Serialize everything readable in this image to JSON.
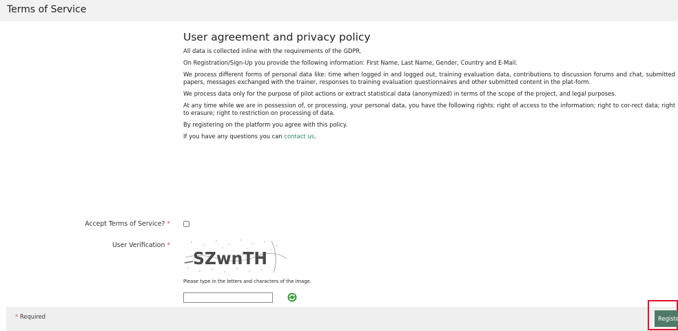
{
  "header": {
    "title": "Terms of Service"
  },
  "policy": {
    "heading": "User agreement and privacy policy",
    "paragraphs": [
      "All data is collected inline with the requirements of the GDPR.",
      "On Registration/Sign-Up you provide the following information: First Name, Last Name, Gender, Country and E-Mail.",
      "We process different forms of personal data like: time when logged in and logged out, training evaluation data, contributions to discussion forums and chat, submitted papers, messages exchanged with the trainer, responses to training evaluation questionnaires and other submitted content in the plat-form.",
      "We process data only for the purpose of pilot actions or extract statistical data (anonymized) in terms of the scope of the project, and legal purposes.",
      "At any time while we are in possession of, or processing, your personal data, you have the following rights: right of access to the information; right to cor-rect data; right to erasure; right to restriction on processing of data.",
      "By registering on the platform you agree with this policy."
    ],
    "contact_prefix": "If you have any questions you can ",
    "contact_link": "contact us",
    "contact_suffix": "."
  },
  "form": {
    "accept_label": "Accept Terms of Service?",
    "verification_label": "User Verification",
    "required_mark": "*",
    "captcha_text": "SZwnTH",
    "captcha_hint": "Please type in the letters and characters of the image.",
    "captcha_value": ""
  },
  "footer": {
    "required_mark": "*",
    "required_text": " Required",
    "register_label": "Register"
  },
  "colors": {
    "accent": "#4f7a66",
    "link": "#2a8a6e",
    "required": "#d9534f",
    "highlight": "#e0102a"
  }
}
